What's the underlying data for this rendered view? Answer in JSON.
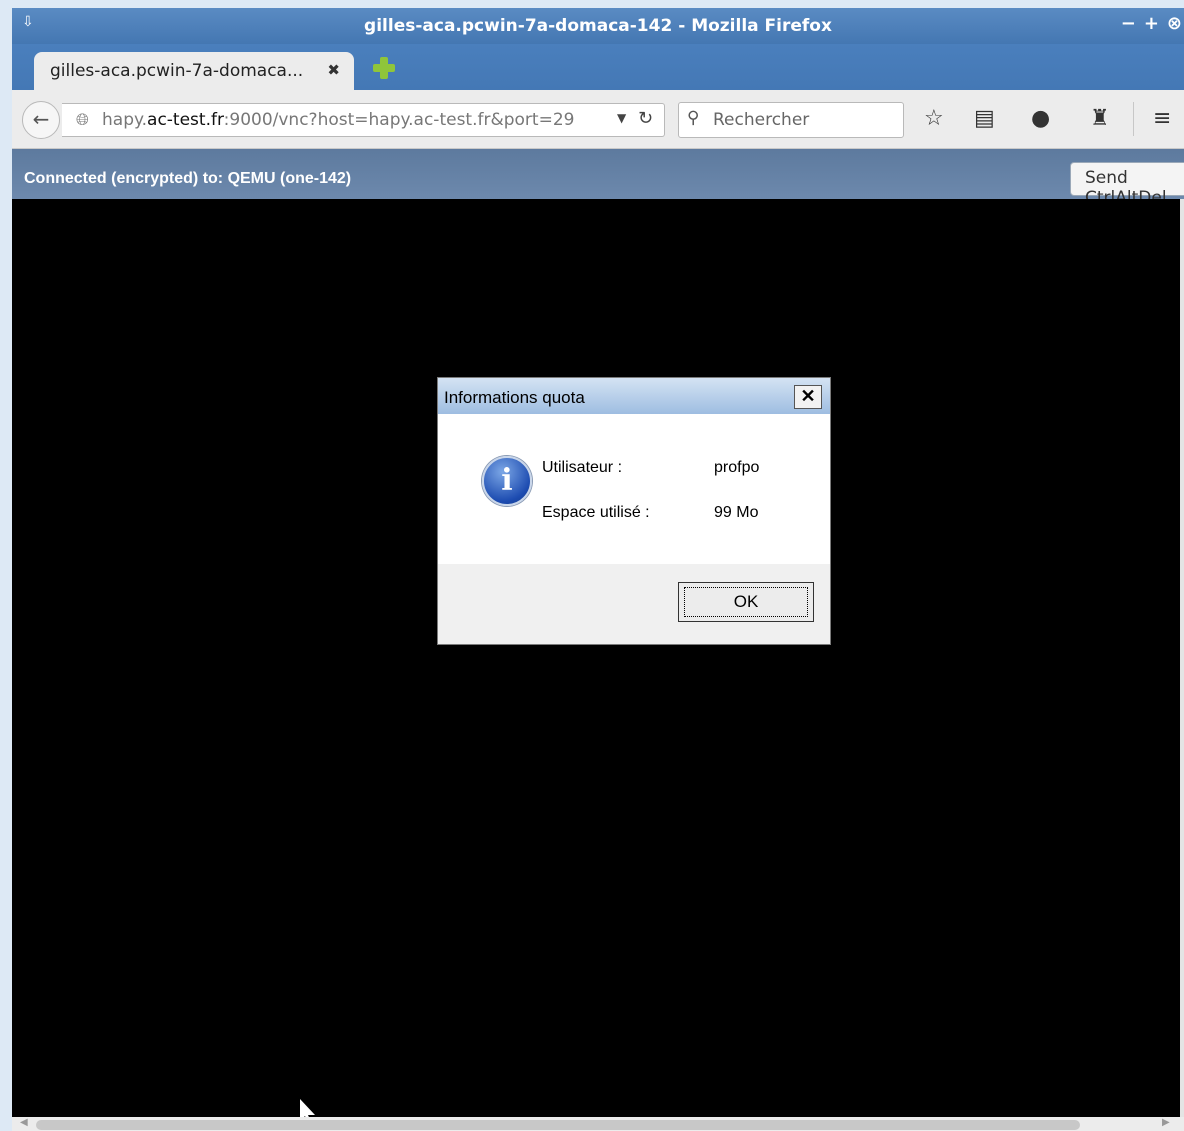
{
  "window": {
    "title": "gilles-aca.pcwin-7a-domaca-142 - Mozilla Firefox",
    "menu_glyph": "⇩",
    "controls": [
      "−",
      "+",
      "⊗"
    ]
  },
  "tabs": [
    {
      "label": "gilles-aca.pcwin-7a-domaca...",
      "close": "✖"
    }
  ],
  "navbar": {
    "back_glyph": "←",
    "url_prefix": "hapy.",
    "url_domain": "ac-test.fr",
    "url_rest": ":9000/vnc?host=hapy.ac-test.fr&port=29",
    "search_placeholder": "Rechercher",
    "icons": [
      "star-icon",
      "reading-list-icon",
      "chat-icon",
      "ghost-icon",
      "hamburger-menu-icon"
    ]
  },
  "vnc": {
    "status": "Connected (encrypted) to: QEMU (one-142)",
    "send_button": "Send CtrlAltDel"
  },
  "dialog": {
    "title": "Informations quota",
    "close_glyph": "✕",
    "user_label": "Utilisateur :",
    "user_value": "profpo",
    "space_label": "Espace utilisé :",
    "space_value": "99 Mo",
    "ok_label": "OK"
  }
}
